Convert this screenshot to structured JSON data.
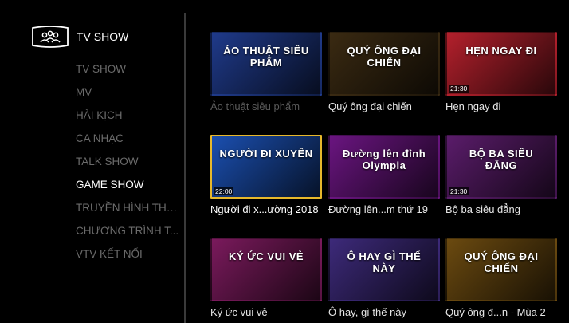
{
  "header": {
    "title": "TV SHOW",
    "icon": "group-screen-icon"
  },
  "menu": [
    {
      "label": "TV SHOW",
      "active": false
    },
    {
      "label": "MV",
      "active": false
    },
    {
      "label": "HÀI KỊCH",
      "active": false
    },
    {
      "label": "CA NHẠC",
      "active": false
    },
    {
      "label": "TALK SHOW",
      "active": false
    },
    {
      "label": "GAME SHOW",
      "active": true
    },
    {
      "label": "TRUYỀN HÌNH THỰ...",
      "active": false
    },
    {
      "label": "CHƯƠNG TRÌNH T...",
      "active": false
    },
    {
      "label": "VTV KẾT NỐI",
      "active": false
    }
  ],
  "tiles": [
    {
      "title": "Ảo thuật siêu phẩm",
      "art": "ẢO THUẬT SIÊU PHẨM",
      "time": "",
      "bg": "#1f3a8a",
      "dim": true
    },
    {
      "title": "Quý ông đại chiến",
      "art": "QUÝ ÔNG ĐẠI CHIẾN",
      "time": "",
      "bg": "#3a2a12",
      "dim": false
    },
    {
      "title": "Hẹn ngay đi",
      "art": "HẸN NGAY ĐI",
      "time": "21:30",
      "bg": "#b3202c",
      "dim": false
    },
    {
      "title": "Người đi x...ường 2018",
      "art": "NGƯỜI ĐI XUYÊN",
      "time": "22:00",
      "bg": "#1b4fb0",
      "dim": false,
      "selected": true
    },
    {
      "title": "Đường lên...m thứ 19",
      "art": "Đường lên đỉnh Olympia",
      "time": "",
      "bg": "#6a1580",
      "dim": false
    },
    {
      "title": "Bộ ba siêu đẳng",
      "art": "BỘ BA SIÊU ĐẲNG",
      "time": "21:30",
      "bg": "#5a1c6a",
      "dim": false
    },
    {
      "title": "Ký ức vui vẻ",
      "art": "KÝ ỨC VUI VẺ",
      "time": "",
      "bg": "#7a1a5c",
      "dim": false
    },
    {
      "title": "Ô hay, gì thế này",
      "art": "Ô HAY GÌ THẾ NÀY",
      "time": "",
      "bg": "#3d2a7a",
      "dim": false
    },
    {
      "title": "Quý ông đ...n - Mùa 2",
      "art": "QUÝ ÔNG ĐẠI CHIẾN",
      "time": "",
      "bg": "#6b4a10",
      "dim": false
    }
  ]
}
